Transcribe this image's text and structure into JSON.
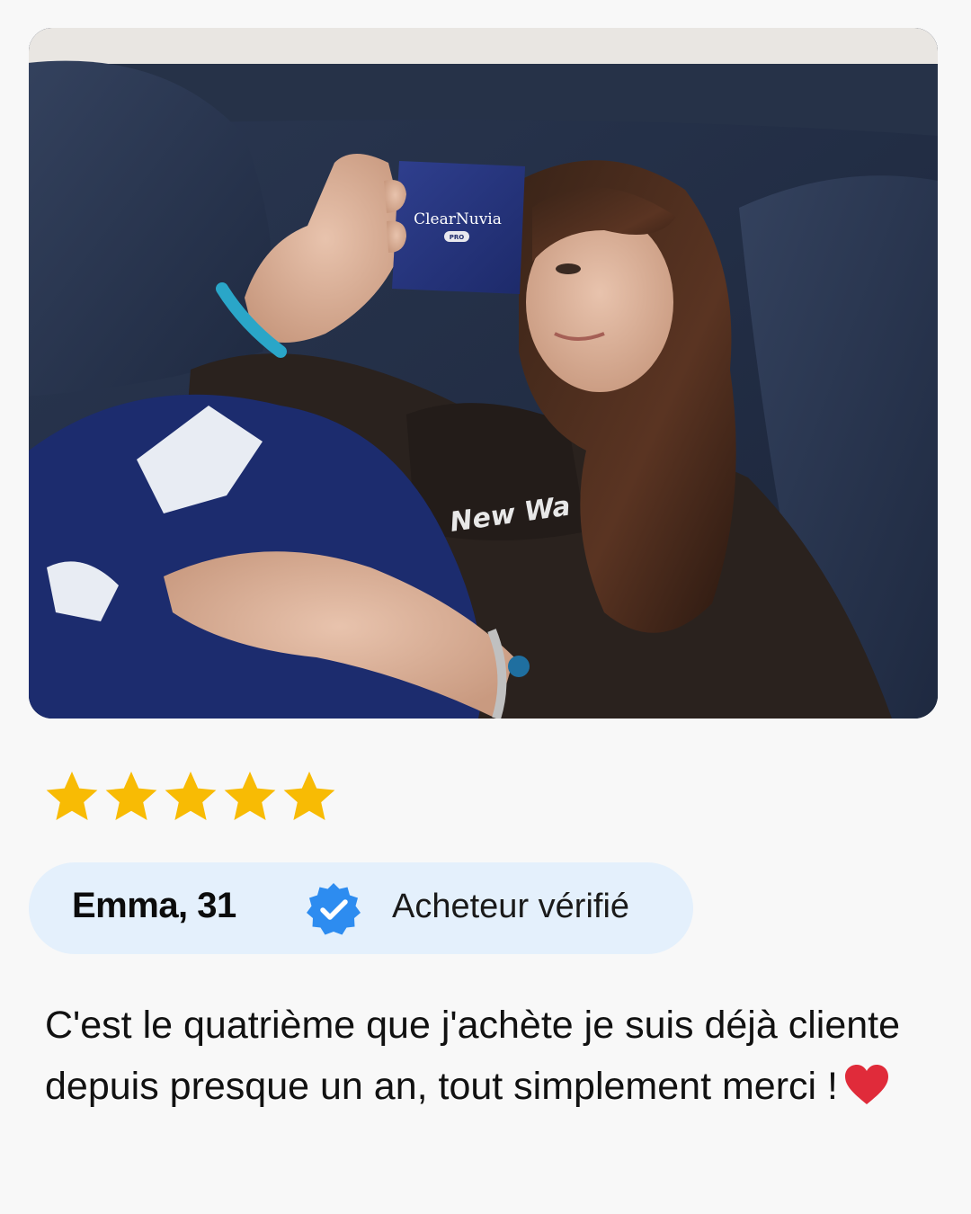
{
  "photo": {
    "product_brand": "ClearNuvia",
    "product_badge": "PRO",
    "sweatshirt_print": "New Wa"
  },
  "rating": {
    "stars": 5,
    "max": 5,
    "color": "#f8bb04"
  },
  "reviewer": {
    "name": "Emma, 31",
    "verified_label": "Acheteur vérifié",
    "verified_icon": "verified-badge-icon",
    "badge_color": "#2d8cf0",
    "pill_color": "#e4f0fc"
  },
  "review": {
    "text": "C'est le quatrième que j'achète je suis déjà cliente depuis presque un an, tout simplement merci !",
    "emoji": "heart-icon",
    "emoji_color": "#e02b3a"
  }
}
